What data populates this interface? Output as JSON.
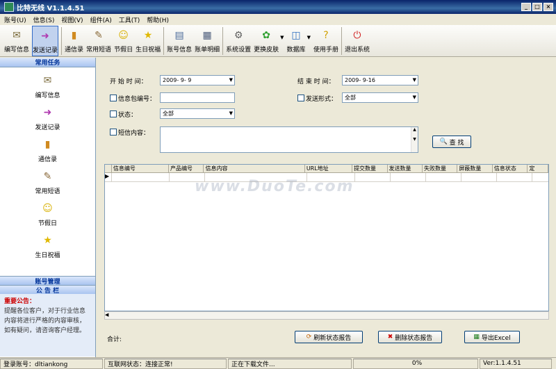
{
  "window": {
    "title": "比特无线 V1.1.4.51"
  },
  "menu": [
    "账号(U)",
    "信息(S)",
    "视图(V)",
    "组件(A)",
    "工具(T)",
    "帮助(H)"
  ],
  "toolbar": [
    {
      "label": "编写信息",
      "icon": "envelope-icon",
      "glyph": "✉",
      "color": "#7a6a3a"
    },
    {
      "label": "发送记录",
      "icon": "send-record-icon",
      "glyph": "➜",
      "color": "#b03ab0",
      "active": true
    },
    {
      "label": "通信录",
      "icon": "address-book-icon",
      "glyph": "▮",
      "color": "#d08a20"
    },
    {
      "label": "常用短语",
      "icon": "notebook-icon",
      "glyph": "✎",
      "color": "#8a6a3a"
    },
    {
      "label": "节假日",
      "icon": "smiley-icon",
      "glyph": "☺",
      "color": "#d8b000"
    },
    {
      "label": "生日祝福",
      "icon": "star-icon",
      "glyph": "★",
      "color": "#e0b800"
    },
    {
      "label": "账号信息",
      "icon": "document-icon",
      "glyph": "▤",
      "color": "#4a6a9a"
    },
    {
      "label": "账单明细",
      "icon": "keyboard-icon",
      "glyph": "▦",
      "color": "#4a5a7a"
    },
    {
      "label": "系统设置",
      "icon": "gears-icon",
      "glyph": "⚙",
      "color": "#606060"
    },
    {
      "label": "更换皮肤",
      "icon": "skin-icon",
      "glyph": "✿",
      "color": "#30a030"
    },
    {
      "label": "数据库",
      "icon": "database-icon",
      "glyph": "◫",
      "color": "#3070c0"
    },
    {
      "label": "使用手册",
      "icon": "help-book-icon",
      "glyph": "?",
      "color": "#d0a000"
    },
    {
      "label": "退出系统",
      "icon": "power-icon",
      "glyph": "⏻",
      "color": "#d02020"
    }
  ],
  "sidebar": {
    "header": "常用任务",
    "items": [
      {
        "label": "编写信息",
        "icon": "envelope-icon",
        "glyph": "✉",
        "color": "#7a6a3a"
      },
      {
        "label": "发送记录",
        "icon": "send-record-icon",
        "glyph": "➜",
        "color": "#b03ab0"
      },
      {
        "label": "通信录",
        "icon": "address-book-icon",
        "glyph": "▮",
        "color": "#d08a20"
      },
      {
        "label": "常用短语",
        "icon": "notebook-icon",
        "glyph": "✎",
        "color": "#8a6a3a"
      },
      {
        "label": "节假日",
        "icon": "smiley-icon",
        "glyph": "☺",
        "color": "#d8b000"
      },
      {
        "label": "生日祝福",
        "icon": "star-icon",
        "glyph": "★",
        "color": "#e0b800"
      }
    ],
    "account_mgmt": "账号管理",
    "bulletin": "公 告 栏",
    "notice_title": "重要公告：",
    "notice_text": "提醒各位客户，对于行业信息内容将进行严格的内容审核，如有疑问，请咨询客户经理。"
  },
  "form": {
    "start_time_label": "开 始 时 间：",
    "start_time_value": "2009- 9- 9",
    "end_time_label": "结 束 时 间：",
    "end_time_value": "2009- 9-16",
    "package_no_label": "信息包编号：",
    "package_no_value": "",
    "send_mode_label": "发送形式：",
    "send_mode_value": "全部",
    "status_label": "状态：",
    "status_value": "全部",
    "content_label": "短信内容：",
    "content_value": "",
    "search_label": "查 找"
  },
  "grid": {
    "columns": [
      "信息编号",
      "产品编号",
      "信息内容",
      "URL地址",
      "提交数量",
      "发送数量",
      "失败数量",
      "屏蔽数量",
      "信息状态",
      "定"
    ]
  },
  "footer": {
    "total_label": "合计:",
    "refresh_label": "刷新状态报告",
    "delete_label": "删除状态报告",
    "export_label": "导出Excel"
  },
  "watermark": "www.DuoTe.com",
  "statusbar": {
    "account": "登录账号：dltiankong",
    "network": "互联网状态：连接正常!",
    "download": "正在下载文件...",
    "progress": "0%",
    "version": "Ver:1.1.4.51"
  }
}
